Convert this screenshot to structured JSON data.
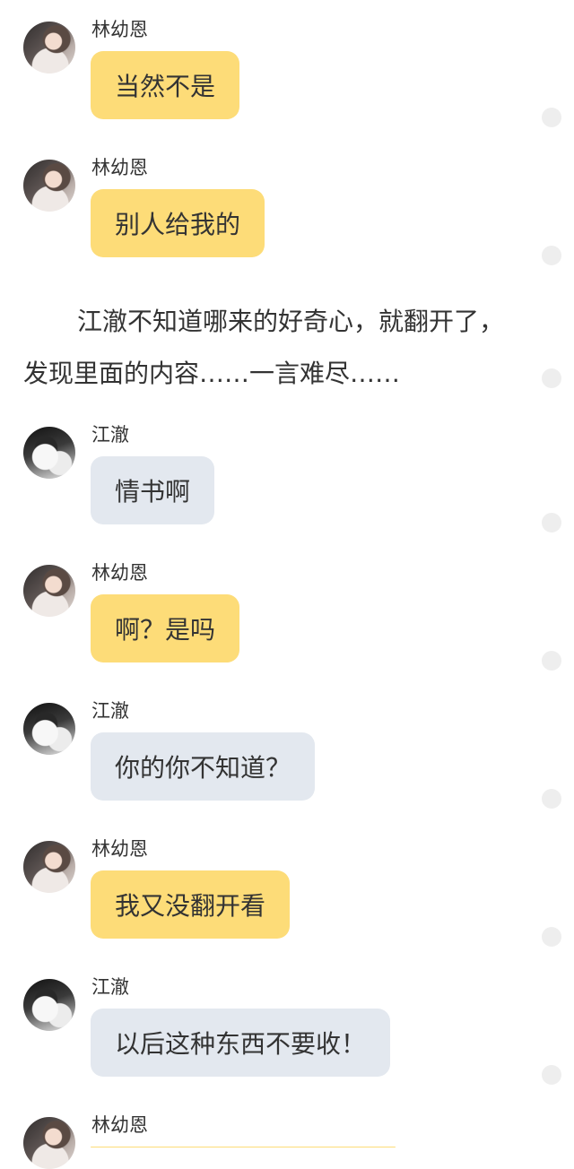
{
  "chat": {
    "messages": [
      {
        "speaker": "林幼恩",
        "text": "当然不是"
      },
      {
        "speaker": "林幼恩",
        "text": "别人给我的"
      },
      {
        "speaker": "江澈",
        "text": "情书啊"
      },
      {
        "speaker": "林幼恩",
        "text": "啊？是吗"
      },
      {
        "speaker": "江澈",
        "text": "你的你不知道？"
      },
      {
        "speaker": "林幼恩",
        "text": "我又没翻开看"
      },
      {
        "speaker": "江澈",
        "text": "以后这种东西不要收！"
      },
      {
        "speaker": "林幼恩",
        "text": ""
      }
    ],
    "narration": "江澈不知道哪来的好奇心，就翻开了，发现里面的内容……一言难尽……"
  }
}
